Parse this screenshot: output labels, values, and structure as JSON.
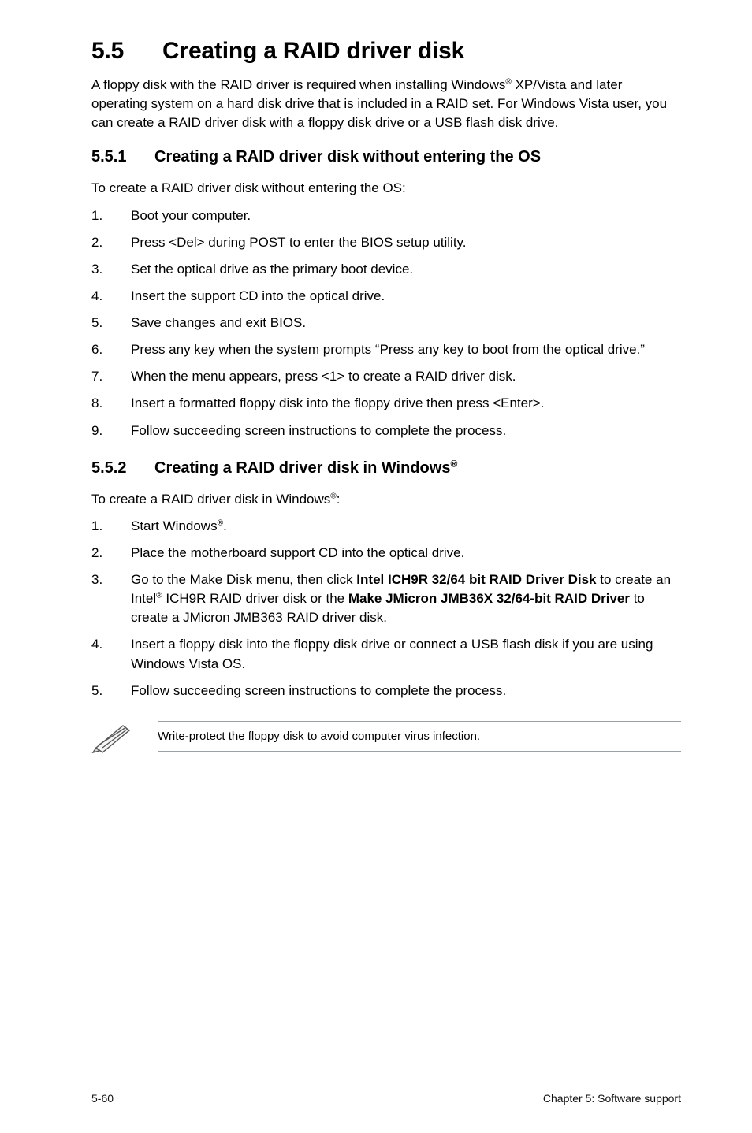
{
  "heading": {
    "number": "5.5",
    "title": "Creating a RAID driver disk"
  },
  "intro": {
    "p1a": "A floppy disk with the RAID driver is required when installing Windows",
    "reg1": "®",
    "p1b": " XP/Vista and later operating system on a hard disk drive that is included in a RAID set. For Windows Vista user, you can create a RAID driver disk with a floppy disk drive or a USB flash disk drive."
  },
  "s551": {
    "number": "5.5.1",
    "title": "Creating a RAID driver disk without entering the OS",
    "lead": "To create a RAID driver disk without entering the OS:",
    "steps": [
      "Boot your computer.",
      "Press <Del> during POST to enter the BIOS setup utility.",
      "Set the optical drive as the primary boot device.",
      "Insert the support CD into the optical drive.",
      "Save changes and exit BIOS.",
      "Press any key when the system prompts “Press any key to boot from the optical drive.”",
      "When the menu appears, press <1> to create a RAID driver disk.",
      "Insert a formatted floppy disk into the floppy drive then press <Enter>.",
      "Follow succeeding screen instructions to complete the process."
    ]
  },
  "s552": {
    "number": "5.5.2",
    "title_a": "Creating a RAID driver disk in Windows",
    "title_reg": "®",
    "lead_a": "To create a RAID driver disk in Windows",
    "lead_reg": "®",
    "lead_b": ":",
    "step1_a": "Start Windows",
    "step1_reg": "®",
    "step1_b": ".",
    "step2": "Place the motherboard support CD into the optical drive.",
    "step3_a": "Go to the Make Disk menu, then click ",
    "step3_b1": "Intel ICH9R 32/64 bit RAID Driver Disk",
    "step3_c": " to create an Intel",
    "step3_reg": "®",
    "step3_d": " ICH9R RAID driver disk or the ",
    "step3_b2": "Make JMicron JMB36X 32/64-bit RAID Driver",
    "step3_e": " to create a JMicron JMB363 RAID driver disk.",
    "step4": "Insert a floppy disk into the floppy disk drive or connect a USB flash disk if you are using Windows Vista OS.",
    "step5": "Follow succeeding screen instructions to complete the process."
  },
  "note": {
    "text": "Write-protect the floppy disk to avoid computer virus infection."
  },
  "footer": {
    "left": "5-60",
    "right": "Chapter 5: Software support"
  }
}
